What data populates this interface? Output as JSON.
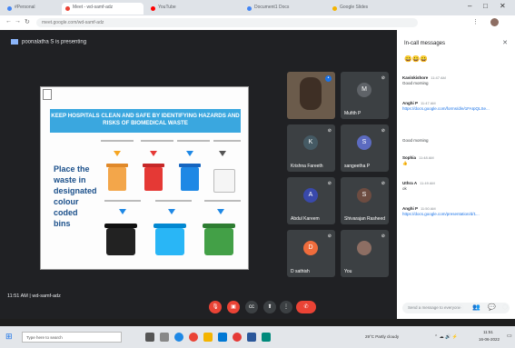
{
  "browser": {
    "tabs": [
      {
        "label": "#Personal",
        "color": "#4285f4"
      },
      {
        "label": "Meet - wd-samf-adz",
        "color": "#ea4335"
      },
      {
        "label": "YouTube",
        "color": "#ff0000"
      },
      {
        "label": "Document1 Docs",
        "color": "#4285f4"
      },
      {
        "label": "Google Slides",
        "color": "#f4b400"
      }
    ],
    "url": "meet.google.com/wd-samf-adz"
  },
  "meet": {
    "presenting_label": "poonalatha S is presenting",
    "slide": {
      "banner": "KEEP HOSPITALS CLEAN AND SAFE BY IDENTIFYING HAZARDS AND RISKS OF BIOMEDICAL WASTE",
      "left_text": "Place the waste in designated colour coded bins"
    },
    "participants": [
      {
        "name": "",
        "initial": "",
        "color": "#6b5b4b",
        "is_video": true
      },
      {
        "name": "Mufith P",
        "initial": "M",
        "color": "#5f6368"
      },
      {
        "name": "Krishna Fareeth",
        "initial": "K",
        "color": "#455a64"
      },
      {
        "name": "sangeetha P",
        "initial": "S",
        "color": "#5c6bc0"
      },
      {
        "name": "Abdul Kareem",
        "initial": "A",
        "color": "#3949ab"
      },
      {
        "name": "Shivarajan Rasheed",
        "initial": "S",
        "color": "#6d4c41"
      },
      {
        "name": "D sathish",
        "initial": "D",
        "color": "#ef6c3c"
      },
      {
        "name": "You",
        "initial": "",
        "color": "#8d6e63"
      }
    ],
    "chat": {
      "title": "In-call messages",
      "close_icon": "close-icon",
      "top_emoji": "😀😀😀",
      "messages": [
        {
          "sender": "Kavinkishore",
          "time": "11:47 AM",
          "text": "Good morning",
          "link": ""
        },
        {
          "sender": "Anghi P",
          "time": "11:47 AM",
          "text": "",
          "link": "https://docs.google.com/forms/d/e/1FAIpQLSe..."
        },
        {
          "sender": "",
          "time": "",
          "text": "Good morning",
          "link": ""
        },
        {
          "sender": "Sophia",
          "time": "11:48 AM",
          "text": "👍",
          "link": ""
        },
        {
          "sender": "Uthra A",
          "time": "11:49 AM",
          "text": "ok",
          "link": ""
        },
        {
          "sender": "Anghi P",
          "time": "11:50 AM",
          "text": "",
          "link": "https://docs.google.com/presentation/d/1..."
        }
      ],
      "input_placeholder": "Send a message to everyone"
    },
    "clock": "11:51 AM",
    "meeting_code": "wd-samf-adz"
  },
  "taskbar": {
    "search_placeholder": "Type here to search",
    "weather": "29°C Partly cloudy",
    "time": "11:51",
    "date": "16-06-2022"
  }
}
